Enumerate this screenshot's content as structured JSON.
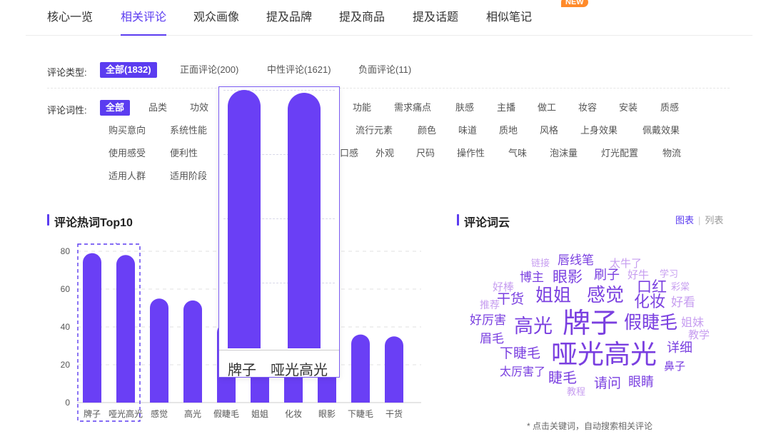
{
  "tabs": [
    {
      "label": "核心一览",
      "active": false
    },
    {
      "label": "相关评论",
      "active": true
    },
    {
      "label": "观众画像",
      "active": false
    },
    {
      "label": "提及品牌",
      "active": false
    },
    {
      "label": "提及商品",
      "active": false
    },
    {
      "label": "提及话题",
      "active": false
    },
    {
      "label": "相似笔记",
      "active": false
    }
  ],
  "new_badge": "NEW",
  "filters": {
    "type_label": "评论类型:",
    "types": [
      "全部(1832)",
      "正面评论(200)",
      "中性评论(1621)",
      "负面评论(11)"
    ],
    "prop_label": "评论词性:",
    "props": [
      "全部",
      "品类",
      "功效",
      "功能",
      "需求痛点",
      "肤感",
      "主播",
      "做工",
      "妆容",
      "安装",
      "质感",
      "购买意向",
      "系统性能",
      "流行元素",
      "颜色",
      "味道",
      "质地",
      "风格",
      "上身效果",
      "佩戴效果",
      "使用感受",
      "便利性",
      "口感",
      "外观",
      "尺码",
      "操作性",
      "气味",
      "泡沫量",
      "灯光配置",
      "物流",
      "适用人群",
      "适用阶段"
    ]
  },
  "hotwords": {
    "title": "评论热词Top10"
  },
  "wordcloud": {
    "title": "评论词云",
    "view_chart": "图表",
    "view_list": "列表",
    "words": [
      "链接",
      "唇线笔",
      "太牛了",
      "博主",
      "眼影",
      "刷子",
      "好牛",
      "学习",
      "好棒",
      "彩棠",
      "干货",
      "姐姐",
      "感觉",
      "口红",
      "推荐",
      "化妆",
      "好看",
      "好厉害",
      "高光",
      "牌子",
      "假睫毛",
      "姐妹",
      "眉毛",
      "教学",
      "详细",
      "下睫毛",
      "哑光高光",
      "鼻子",
      "太厉害了",
      "睫毛",
      "请问",
      "眼睛",
      "教程"
    ],
    "footnote": "* 点击关键词，自动搜索相关评论"
  },
  "colors": {
    "accent": "#5b3cf0",
    "bar": "#6a3ff5",
    "cloud_dark": "#7a3fe0",
    "cloud_light": "#c79ef0"
  },
  "chart_data": {
    "type": "bar",
    "categories": [
      "牌子",
      "哑光高光",
      "感觉",
      "高光",
      "假睫毛",
      "姐姐",
      "化妆",
      "眼影",
      "下睫毛",
      "干货"
    ],
    "values": [
      79,
      78,
      55,
      54,
      42,
      40,
      39,
      38,
      36,
      35
    ],
    "ylim": [
      0,
      80
    ],
    "yticks": [
      0,
      20,
      40,
      60,
      80
    ],
    "grid": true,
    "highlight_categories": [
      "牌子",
      "哑光高光"
    ]
  },
  "zoom": {
    "labels": [
      "牌子",
      "哑光高光"
    ]
  }
}
